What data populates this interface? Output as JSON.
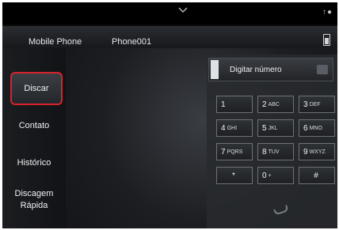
{
  "topbar": {
    "right_icons": "↑●"
  },
  "infobar": {
    "device": "Mobile Phone",
    "phone": "Phone001"
  },
  "sidebar": {
    "items": [
      {
        "label": "Discar"
      },
      {
        "label": "Contato"
      },
      {
        "label": "Histórico"
      },
      {
        "label_line1": "Discagem",
        "label_line2": "Rápida"
      }
    ]
  },
  "keypad": {
    "placeholder": "Digitar número",
    "keys": [
      {
        "num": "1",
        "letters": ""
      },
      {
        "num": "2",
        "letters": "ABC"
      },
      {
        "num": "3",
        "letters": "DEF"
      },
      {
        "num": "4",
        "letters": "GHI"
      },
      {
        "num": "5",
        "letters": "JKL"
      },
      {
        "num": "6",
        "letters": "MNO"
      },
      {
        "num": "7",
        "letters": "PQRS"
      },
      {
        "num": "8",
        "letters": "TUV"
      },
      {
        "num": "9",
        "letters": "WXYZ"
      },
      {
        "num": "*",
        "letters": ""
      },
      {
        "num": "0",
        "letters": "+"
      },
      {
        "num": "#",
        "letters": ""
      }
    ]
  },
  "colors": {
    "highlight": "#d8222b"
  }
}
